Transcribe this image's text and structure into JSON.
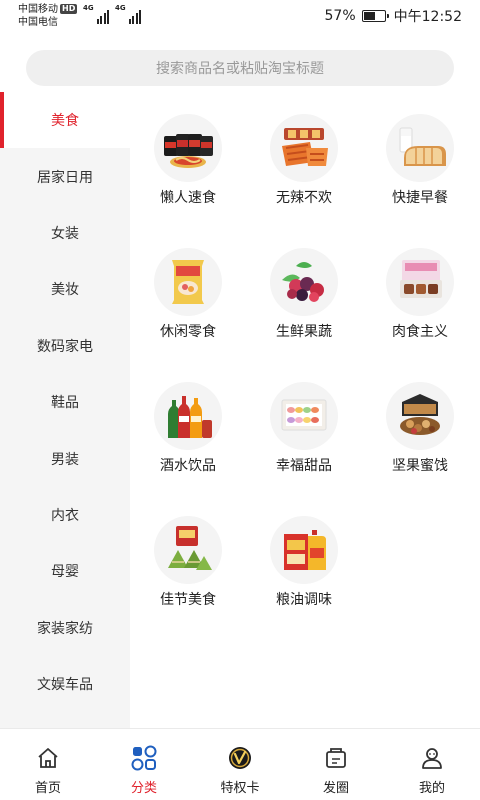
{
  "status_bar": {
    "carrier1": "中国移动",
    "hd_badge": "HD",
    "carrier2": "中国电信",
    "network1": "4G",
    "network2": "4G",
    "battery_percent": "57%",
    "battery_level": 0.57,
    "time": "中午12:52"
  },
  "search": {
    "placeholder": "搜索商品名或粘贴淘宝标题"
  },
  "sidebar": {
    "items": [
      {
        "label": "美食",
        "active": true
      },
      {
        "label": "居家日用"
      },
      {
        "label": "女装"
      },
      {
        "label": "美妆"
      },
      {
        "label": "数码家电"
      },
      {
        "label": "鞋品"
      },
      {
        "label": "男装"
      },
      {
        "label": "内衣"
      },
      {
        "label": "母婴"
      },
      {
        "label": "家装家纺"
      },
      {
        "label": "文娱车品"
      }
    ]
  },
  "categories": [
    {
      "label": "懒人速食",
      "icon": "instant-noodles-icon"
    },
    {
      "label": "无辣不欢",
      "icon": "spicy-snack-icon"
    },
    {
      "label": "快捷早餐",
      "icon": "bread-milk-icon"
    },
    {
      "label": "休闲零食",
      "icon": "snack-bag-icon"
    },
    {
      "label": "生鲜果蔬",
      "icon": "berries-icon"
    },
    {
      "label": "肉食主义",
      "icon": "meat-box-icon"
    },
    {
      "label": "酒水饮品",
      "icon": "drink-bottles-icon"
    },
    {
      "label": "幸福甜品",
      "icon": "macaron-box-icon"
    },
    {
      "label": "坚果蜜饯",
      "icon": "nut-gift-box-icon"
    },
    {
      "label": "佳节美食",
      "icon": "zongzi-icon"
    },
    {
      "label": "粮油调味",
      "icon": "rice-oil-icon"
    }
  ],
  "tabbar": {
    "items": [
      {
        "label": "首页",
        "icon": "home-icon"
      },
      {
        "label": "分类",
        "icon": "category-grid-icon",
        "active": true
      },
      {
        "label": "特权卡",
        "icon": "vip-card-icon"
      },
      {
        "label": "发圈",
        "icon": "share-circle-icon"
      },
      {
        "label": "我的",
        "icon": "profile-icon"
      }
    ]
  },
  "colors": {
    "accent": "#e0222c",
    "sidebar_bg": "#f5f5f5",
    "search_bg": "#efefef"
  }
}
